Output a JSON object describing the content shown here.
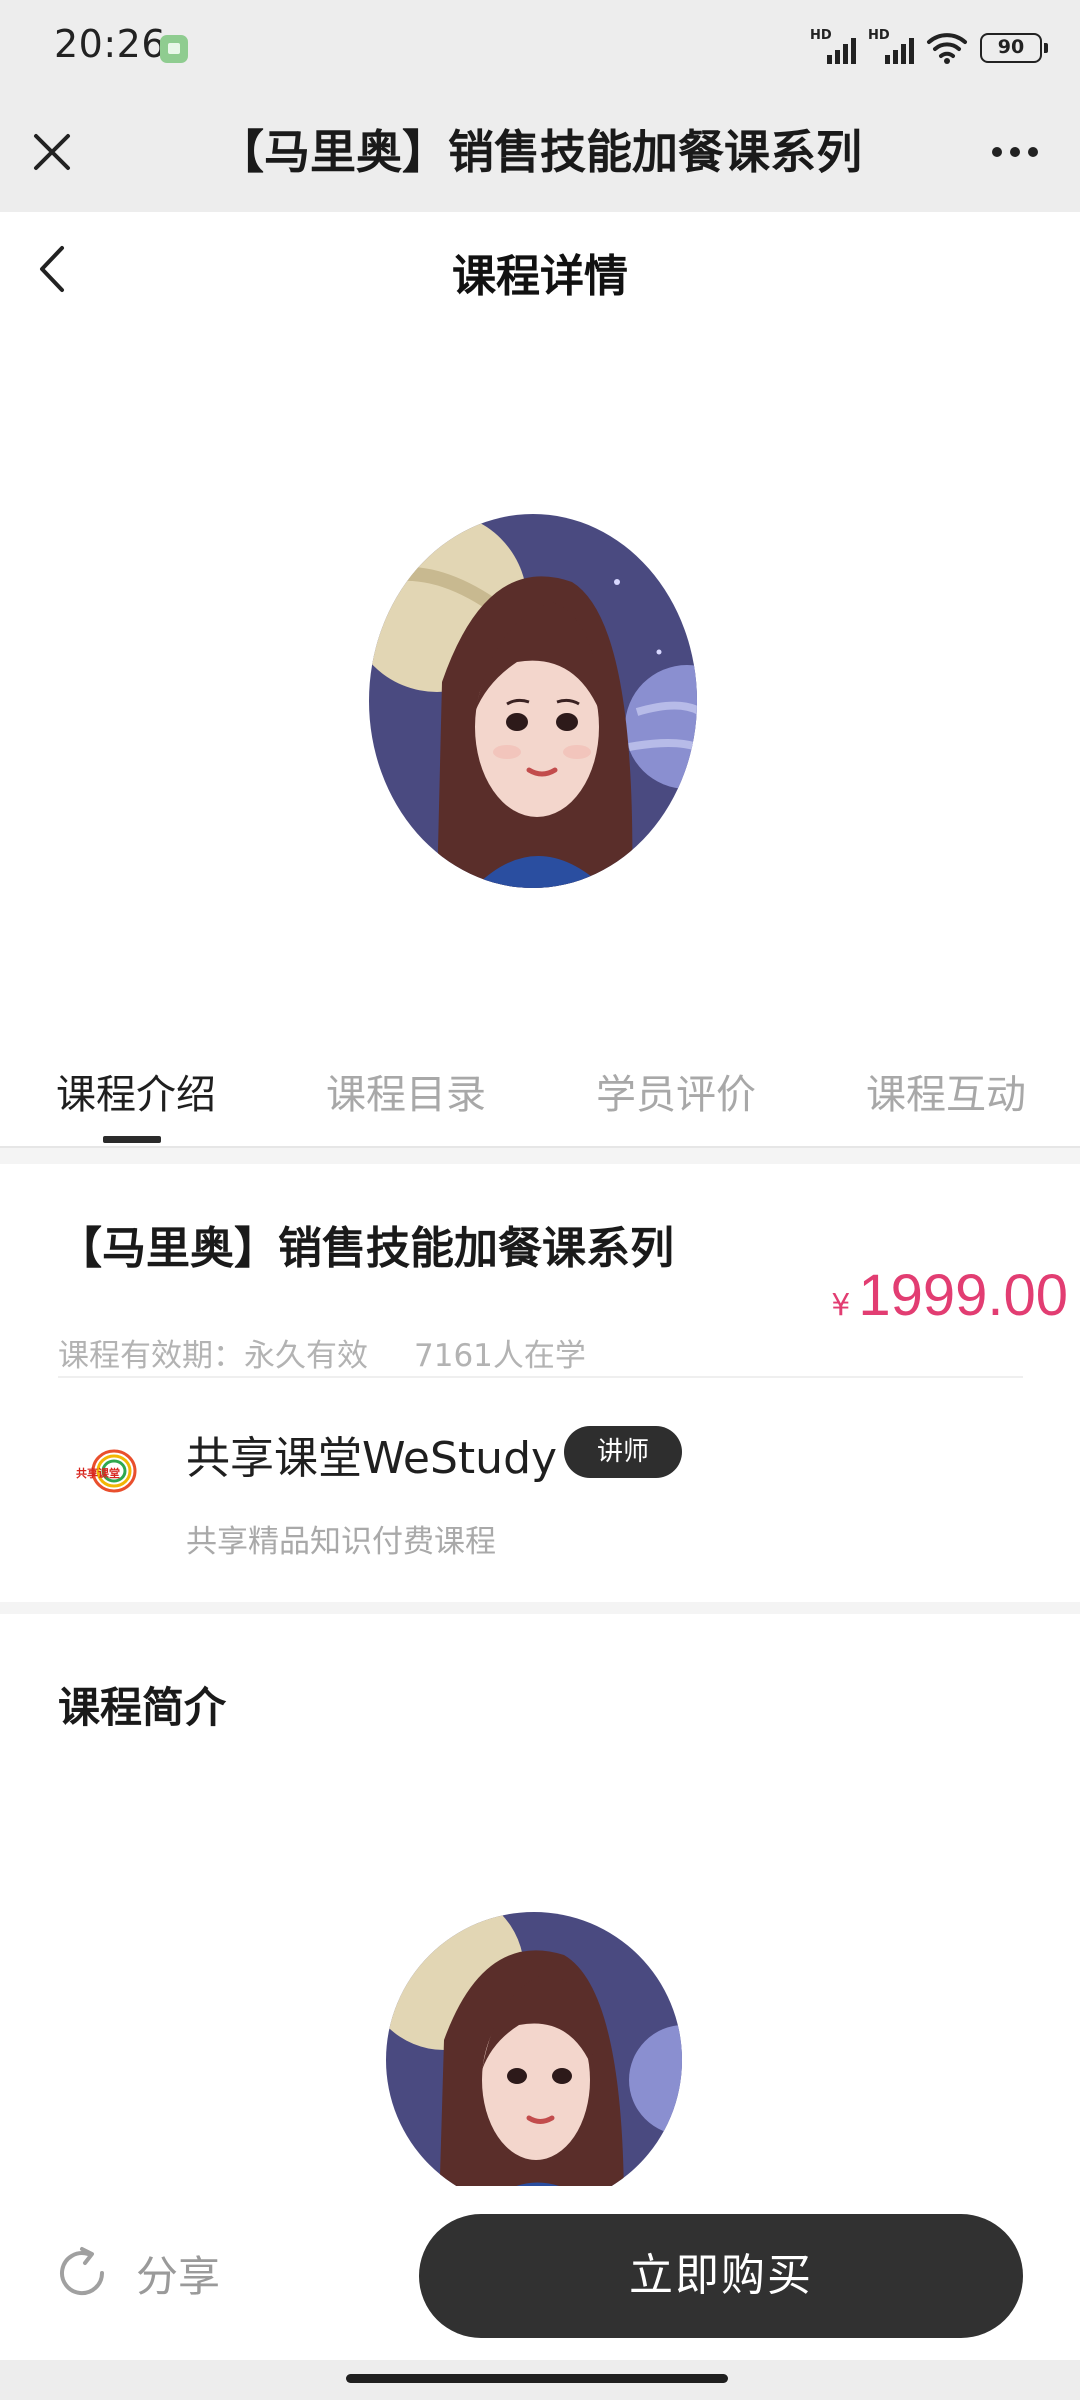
{
  "status_bar": {
    "time": "20:26",
    "network_1": "HD",
    "network_2": "HD",
    "battery": "90"
  },
  "title_bar": {
    "title": "【马里奥】销售技能加餐课系列",
    "close_icon": "close-icon",
    "more_icon": "more-icon"
  },
  "page": {
    "title": "课程详情",
    "back_icon": "back-arrow-icon"
  },
  "tabs": [
    {
      "label": "课程介绍",
      "active": true
    },
    {
      "label": "课程目录",
      "active": false
    },
    {
      "label": "学员评价",
      "active": false
    },
    {
      "label": "课程互动",
      "active": false
    }
  ],
  "course": {
    "title": "【马里奥】销售技能加餐课系列",
    "currency": "¥",
    "price": "1999.00",
    "validity": "课程有效期：永久有效",
    "learners": "7161人在学"
  },
  "teacher": {
    "logo_text": "共享课堂",
    "name": "共享课堂WeStudy",
    "badge": "讲师",
    "description": "共享精品知识付费课程"
  },
  "intro": {
    "heading": "课程简介"
  },
  "bottom_bar": {
    "share_label": "分享",
    "share_icon": "share-icon",
    "buy_label": "立即购买"
  },
  "colors": {
    "price": "#e23d72",
    "button": "#313131",
    "chrome": "#ededed"
  }
}
